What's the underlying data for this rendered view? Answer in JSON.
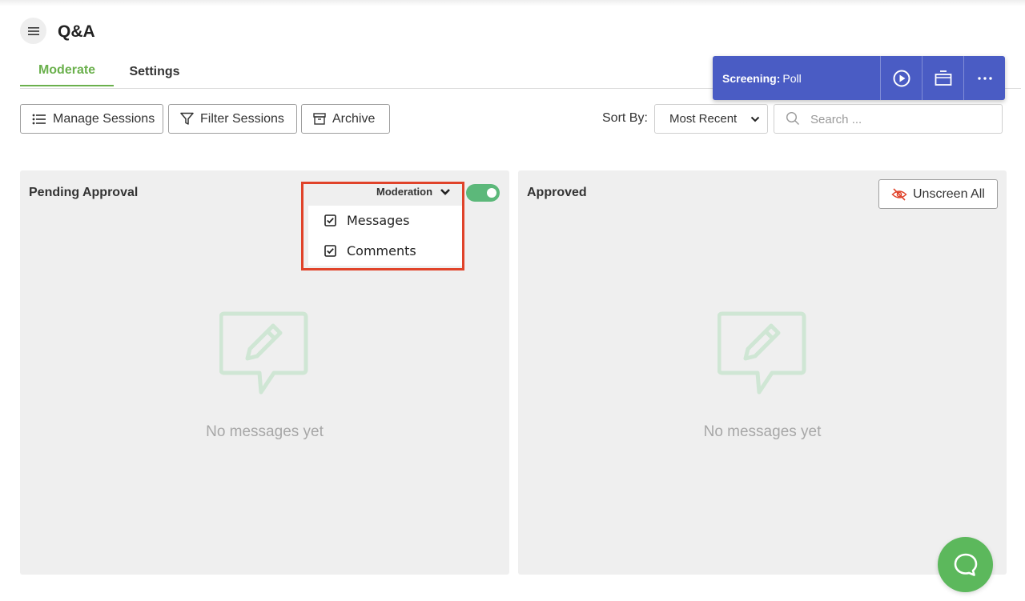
{
  "header": {
    "title": "Q&A",
    "menu_icon": "hamburger-icon"
  },
  "tabs": [
    {
      "label": "Moderate",
      "active": true
    },
    {
      "label": "Settings",
      "active": false
    }
  ],
  "screening": {
    "prefix": "Screening:",
    "value": "Poll",
    "background": "#4a5cc4",
    "actions": [
      "play-icon",
      "screen-icon",
      "more-icon"
    ]
  },
  "toolbar": {
    "manage_sessions": "Manage Sessions",
    "filter_sessions": "Filter Sessions",
    "archive": "Archive",
    "sort_label": "Sort By:",
    "sort_value": "Most Recent",
    "search_placeholder": "Search ..."
  },
  "pending": {
    "title": "Pending Approval",
    "moderation_label": "Moderation",
    "moderation_enabled": true,
    "options": [
      {
        "label": "Messages",
        "checked": true
      },
      {
        "label": "Comments",
        "checked": true
      }
    ],
    "empty_text": "No messages yet"
  },
  "approved": {
    "title": "Approved",
    "unscreen_label": "Unscreen All",
    "empty_text": "No messages yet"
  },
  "colors": {
    "accent_green": "#6ab04c",
    "toggle_green": "#5cb87a",
    "highlight_red": "#e0432a",
    "panel_bg": "#efefef",
    "empty_icon": "#cfe6d4"
  }
}
